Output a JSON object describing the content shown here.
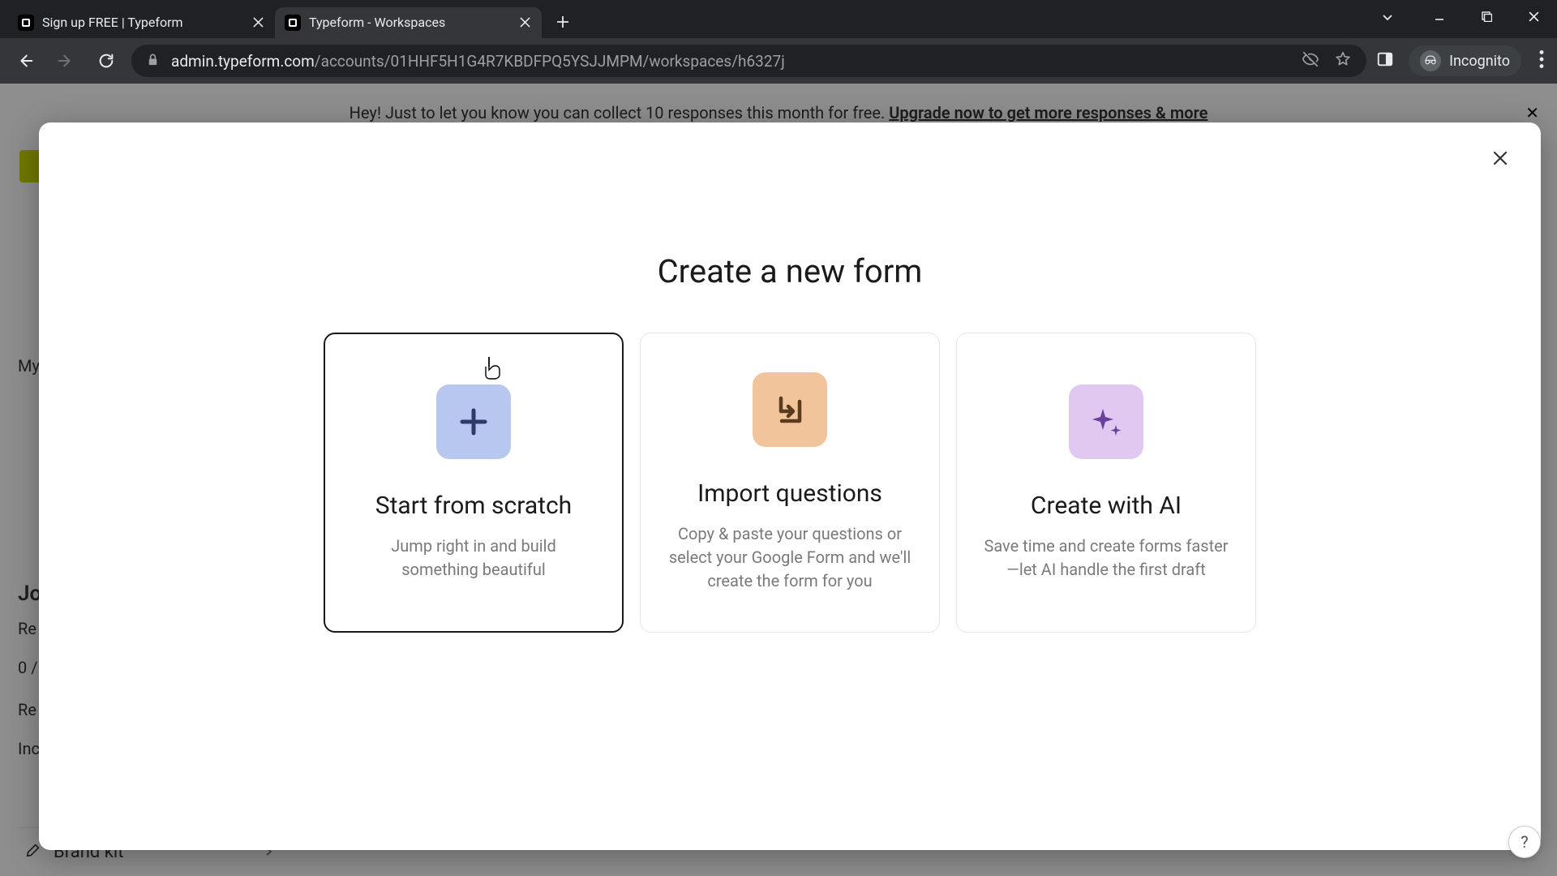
{
  "browser": {
    "tabs": [
      {
        "title": "Sign up FREE | Typeform",
        "active": false
      },
      {
        "title": "Typeform - Workspaces",
        "active": true
      }
    ],
    "url_domain": "admin.typeform.com",
    "url_path": "/accounts/01HHF5H1G4R7KBDFPQ5YSJJMPM/workspaces/h6327j",
    "incognito_label": "Incognito"
  },
  "page": {
    "banner_text": "Hey! Just to let you know you can collect 10 responses this month for free. ",
    "banner_link": "Upgrade now to get more responses & more",
    "sidebar": {
      "my": "My",
      "re1": "Re",
      "header": "Jo",
      "re2": "Re",
      "zero": "0 /",
      "re3": "Re",
      "inc": "Inc",
      "brand_kit": "Brand kit"
    }
  },
  "modal": {
    "title": "Create a new form",
    "options": [
      {
        "title": "Start from scratch",
        "desc": "Jump right in and build something beautiful"
      },
      {
        "title": "Import questions",
        "desc": "Copy & paste your questions or select your Google Form and we'll create the form for you"
      },
      {
        "title": "Create with AI",
        "desc": "Save time and create forms faster—let AI handle the first draft"
      }
    ]
  }
}
